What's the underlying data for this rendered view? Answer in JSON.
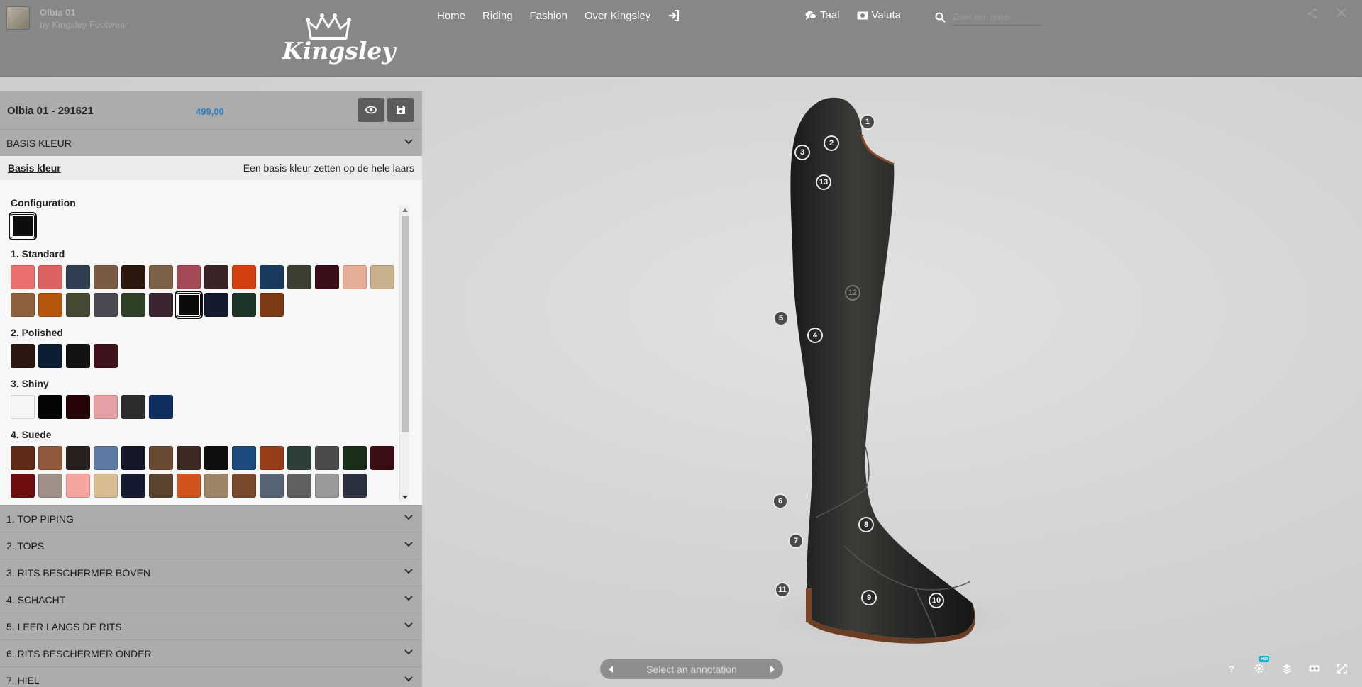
{
  "header": {
    "model_title": "Olbia 01",
    "model_author": "by Kingsley Footwear",
    "logo_text": "Kingsley",
    "nav": [
      "Home",
      "Riding",
      "Fashion",
      "Over Kingsley"
    ],
    "language_label": "Taal",
    "currency_label": "Valuta",
    "search_placeholder": "Zoek een order."
  },
  "product": {
    "name": "Olbia 01 - 291621",
    "price": "499,00"
  },
  "active_section": {
    "title": "BASIS KLEUR",
    "subtab_label": "Basis kleur",
    "subtab_description": "Een basis kleur zetten op de hele laars"
  },
  "swatch_groups": [
    {
      "title": "Configuration",
      "colors": [
        "#0d0d0d"
      ],
      "selected_index": 0
    },
    {
      "title": "1. Standard",
      "colors": [
        "#ea7070",
        "#dc6161",
        "#2f3e50",
        "#7b5a44",
        "#2c180f",
        "#7c6248",
        "#a44a57",
        "#3a2526",
        "#d34012",
        "#173a5e",
        "#3d3f30",
        "#3c0e17",
        "#e6ae96",
        "#c9b08d",
        "#8e603d",
        "#b6560c",
        "#444a33",
        "#4a4a55",
        "#2f4228",
        "#3a2530",
        "#0b0b0b",
        "#141a2c",
        "#1f3527",
        "#7c3a15"
      ],
      "selected_index": 20
    },
    {
      "title": "2. Polished",
      "colors": [
        "#2a1710",
        "#0d1e33",
        "#121314",
        "#3f121b"
      ]
    },
    {
      "title": "3. Shiny",
      "colors": [
        "#f5f5f4",
        "#050505",
        "#260508",
        "#e69fa4",
        "#2c2c2c",
        "#0e2f5e"
      ]
    },
    {
      "title": "4. Suede",
      "colors": [
        "#5e2c14",
        "#8e5a3b",
        "#27201d",
        "#5e7ba3",
        "#141727",
        "#6b4a32",
        "#3d2a22",
        "#0f0f10",
        "#1b4a7c",
        "#973d1a",
        "#2e3e3b",
        "#4b4b4d",
        "#1a2e19",
        "#3a0e14",
        "#6e0d0f",
        "#9e9088",
        "#f6a4a0",
        "#d7bd93",
        "#141a2f",
        "#5a4430",
        "#d1541f",
        "#9e8466",
        "#7a4a2d",
        "#556575",
        "#5f6062",
        "#9a9a9a",
        "#2c3140"
      ]
    }
  ],
  "sections": [
    "1. TOP PIPING",
    "2. TOPS",
    "3. RITS BESCHERMER BOVEN",
    "4. SCHACHT",
    "5. LEER LANGS DE RITS",
    "6. RITS BESCHERMER ONDER",
    "7. HIEL"
  ],
  "annotations": [
    "1",
    "2",
    "3",
    "13",
    "12",
    "5",
    "4",
    "6",
    "8",
    "7",
    "11",
    "9",
    "10"
  ],
  "viewer": {
    "annotation_nav_label": "Select an annotation",
    "hd_badge": "HD",
    "help_label": "?"
  }
}
